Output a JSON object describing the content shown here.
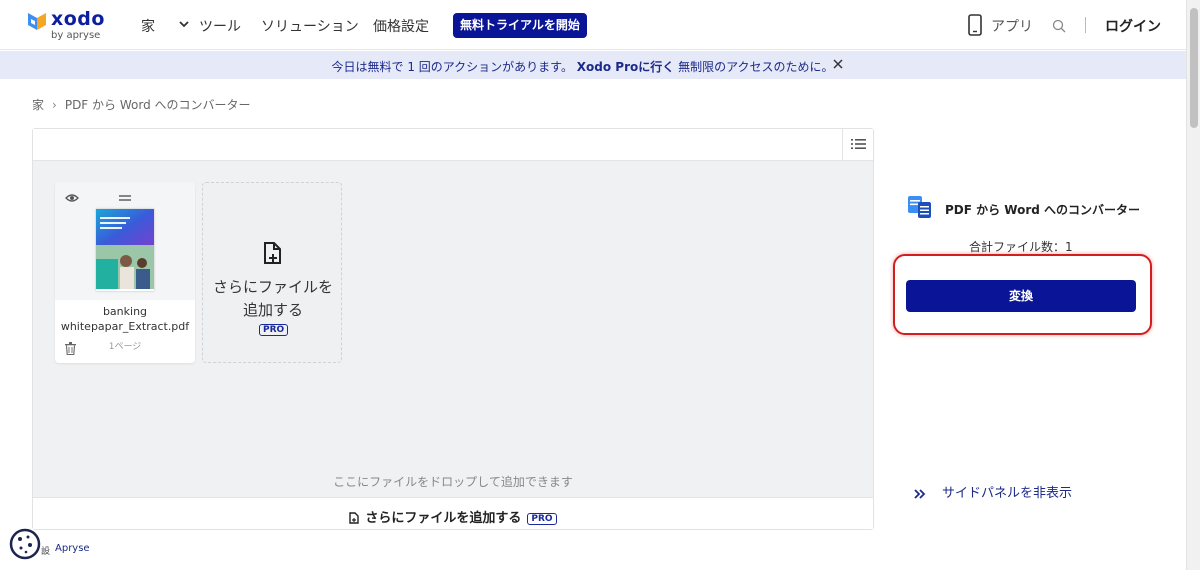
{
  "header": {
    "logo_word": "xodo",
    "logo_sub": "by apryse",
    "nav": {
      "home": "家",
      "tools": "ツール",
      "solutions": "ソリューション",
      "pricing": "価格設定"
    },
    "trial_button": "無料トライアルを開始",
    "apps": "アプリ",
    "login": "ログイン"
  },
  "banner": {
    "text_before": "今日は無料で 1 回のアクションがあります。",
    "link": "Xodo Proに行く",
    "text_after": " 無制限のアクセスのために。"
  },
  "breadcrumb": {
    "home": "家",
    "separator": "›",
    "current": "PDF から Word へのコンバーター"
  },
  "workspace": {
    "file": {
      "name_line1": "banking",
      "name_line2": "whitepapar_Extract.pdf",
      "pages": "1ページ"
    },
    "add_card": {
      "line1": "さらにファイルを",
      "line2": "追加する",
      "badge": "PRO"
    },
    "drop_hint": "ここにファイルをドロップして追加できます",
    "bottom_add": "さらにファイルを追加する",
    "bottom_badge": "PRO"
  },
  "side_panel": {
    "title": "PDF から Word へのコンバーター",
    "file_count": "合計ファイル数：1",
    "convert_button": "変換",
    "hide_panel": "サイドパネルを非表示"
  },
  "footer": {
    "cookie_label": "設",
    "apryse": "Apryse"
  },
  "colors": {
    "primary": "#0a1496",
    "banner_bg": "#e6e9f8",
    "highlight": "#d11f1f"
  }
}
